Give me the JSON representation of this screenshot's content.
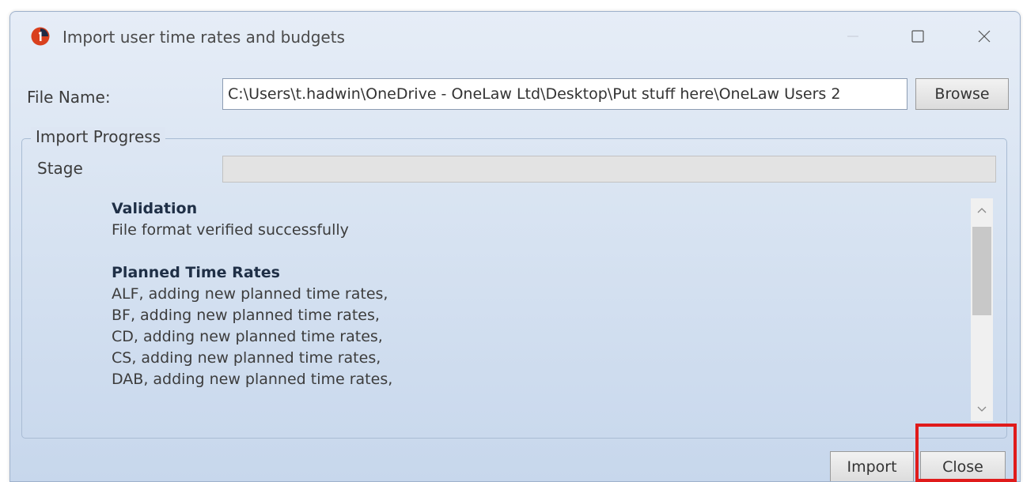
{
  "window": {
    "title": "Import user time rates and budgets",
    "controls": {
      "minimize": "minimize",
      "maximize": "maximize",
      "close": "close"
    }
  },
  "file": {
    "label": "File Name:",
    "value": "C:\\Users\\t.hadwin\\OneDrive - OneLaw Ltd\\Desktop\\Put stuff here\\OneLaw Users 2",
    "browse_label": "Browse"
  },
  "progress": {
    "group_label": "Import Progress",
    "stage_label": "Stage",
    "stage_fraction": 0
  },
  "log": {
    "sections": [
      {
        "heading": "Validation",
        "lines": [
          "File format verified successfully"
        ]
      },
      {
        "heading": "Planned Time Rates",
        "lines": [
          "ALF, adding new planned time rates,",
          "BF, adding new planned time rates,",
          "CD, adding new planned time rates,",
          "CS, adding new planned time rates,",
          "DAB, adding new planned time rates,"
        ]
      }
    ]
  },
  "buttons": {
    "import_label": "Import",
    "close_label": "Close"
  },
  "colors": {
    "highlight": "#e01b1b",
    "app_icon": "#d9401e"
  },
  "icons": {
    "app": "onelaw-logo-icon",
    "scroll_up": "chevron-up-icon",
    "scroll_down": "chevron-down-icon"
  }
}
